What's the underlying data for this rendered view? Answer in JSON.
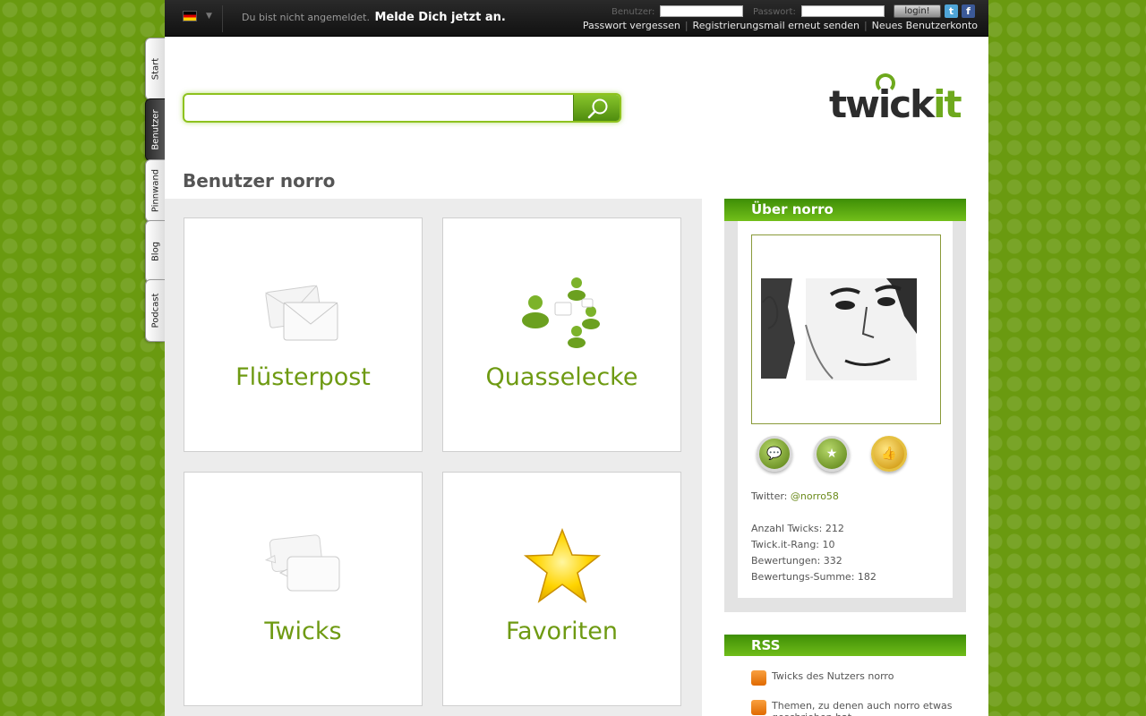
{
  "topbar": {
    "status_text": "Du bist nicht angemeldet.",
    "login_prompt": "Melde Dich jetzt an.",
    "username_label": "Benutzer:",
    "password_label": "Passwort:",
    "login_button": "login!",
    "links": [
      "Passwort vergessen",
      "Registrierungsmail erneut senden",
      "Neues Benutzerkonto"
    ]
  },
  "tabs": [
    "Start",
    "Benutzer",
    "Pinnwand",
    "Blog",
    "Podcast"
  ],
  "search": {
    "placeholder": ""
  },
  "logo": {
    "part1": "twick",
    "part2": "it"
  },
  "page_title": "Benutzer norro",
  "tiles": [
    {
      "label": "Flüsterpost",
      "icon": "envelopes-icon"
    },
    {
      "label": "Quasselecke",
      "icon": "people-chat-icon"
    },
    {
      "label": "Twicks",
      "icon": "speech-bubbles-icon"
    },
    {
      "label": "Favoriten",
      "icon": "star-icon"
    }
  ],
  "about": {
    "header": "Über norro",
    "twitter_label": "Twitter:",
    "twitter_handle": "@norro58",
    "stats": [
      {
        "label": "Anzahl Twicks:",
        "value": "212"
      },
      {
        "label": "Twick.it-Rang:",
        "value": "10"
      },
      {
        "label": "Bewertungen:",
        "value": "332"
      },
      {
        "label": "Bewertungs-Summe:",
        "value": "182"
      }
    ]
  },
  "rss": {
    "header": "RSS",
    "items": [
      "Twicks des Nutzers norro",
      "Themen, zu denen auch norro etwas geschrieben hat"
    ]
  },
  "colors": {
    "accent": "#6e9a12",
    "header_green": "#72bf1a"
  }
}
